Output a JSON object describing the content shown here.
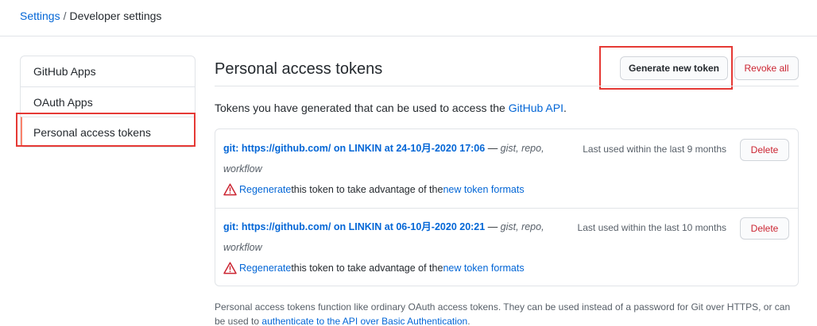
{
  "breadcrumb": {
    "root": "Settings",
    "separator": "/",
    "current": "Developer settings"
  },
  "sidebar": {
    "items": [
      {
        "label": "GitHub Apps"
      },
      {
        "label": "OAuth Apps"
      },
      {
        "label": "Personal access tokens"
      }
    ]
  },
  "header": {
    "title": "Personal access tokens",
    "generate_label": "Generate new token",
    "revoke_label": "Revoke all"
  },
  "intro": {
    "before": "Tokens you have generated that can be used to access the ",
    "link": "GitHub API",
    "after": "."
  },
  "tokens": [
    {
      "name": "git: https://github.com/ on LINKIN at 24-10月-2020 17:06",
      "dash": " — ",
      "scopes": "gist, repo, workflow",
      "last_used": "Last used within the last 9 months",
      "regen_link": "Regenerate",
      "regen_middle": " this token to take advantage of the ",
      "regen_formats": "new token formats",
      "delete_label": "Delete"
    },
    {
      "name": "git: https://github.com/ on LINKIN at 06-10月-2020 20:21",
      "dash": " — ",
      "scopes": "gist, repo, workflow",
      "last_used": "Last used within the last 10 months",
      "regen_link": "Regenerate",
      "regen_middle": " this token to take advantage of the ",
      "regen_formats": "new token formats",
      "delete_label": "Delete"
    }
  ],
  "footer": {
    "text": "Personal access tokens function like ordinary OAuth access tokens. They can be used instead of a password for Git over HTTPS, or can be used to ",
    "link": "authenticate to the API over Basic Authentication",
    "end": "."
  },
  "colors": {
    "link": "#0366d6",
    "danger": "#cb2431",
    "highlight": "#e53935",
    "warning": "#cb2431"
  },
  "icons": {
    "warning": "alert-triangle-icon"
  }
}
